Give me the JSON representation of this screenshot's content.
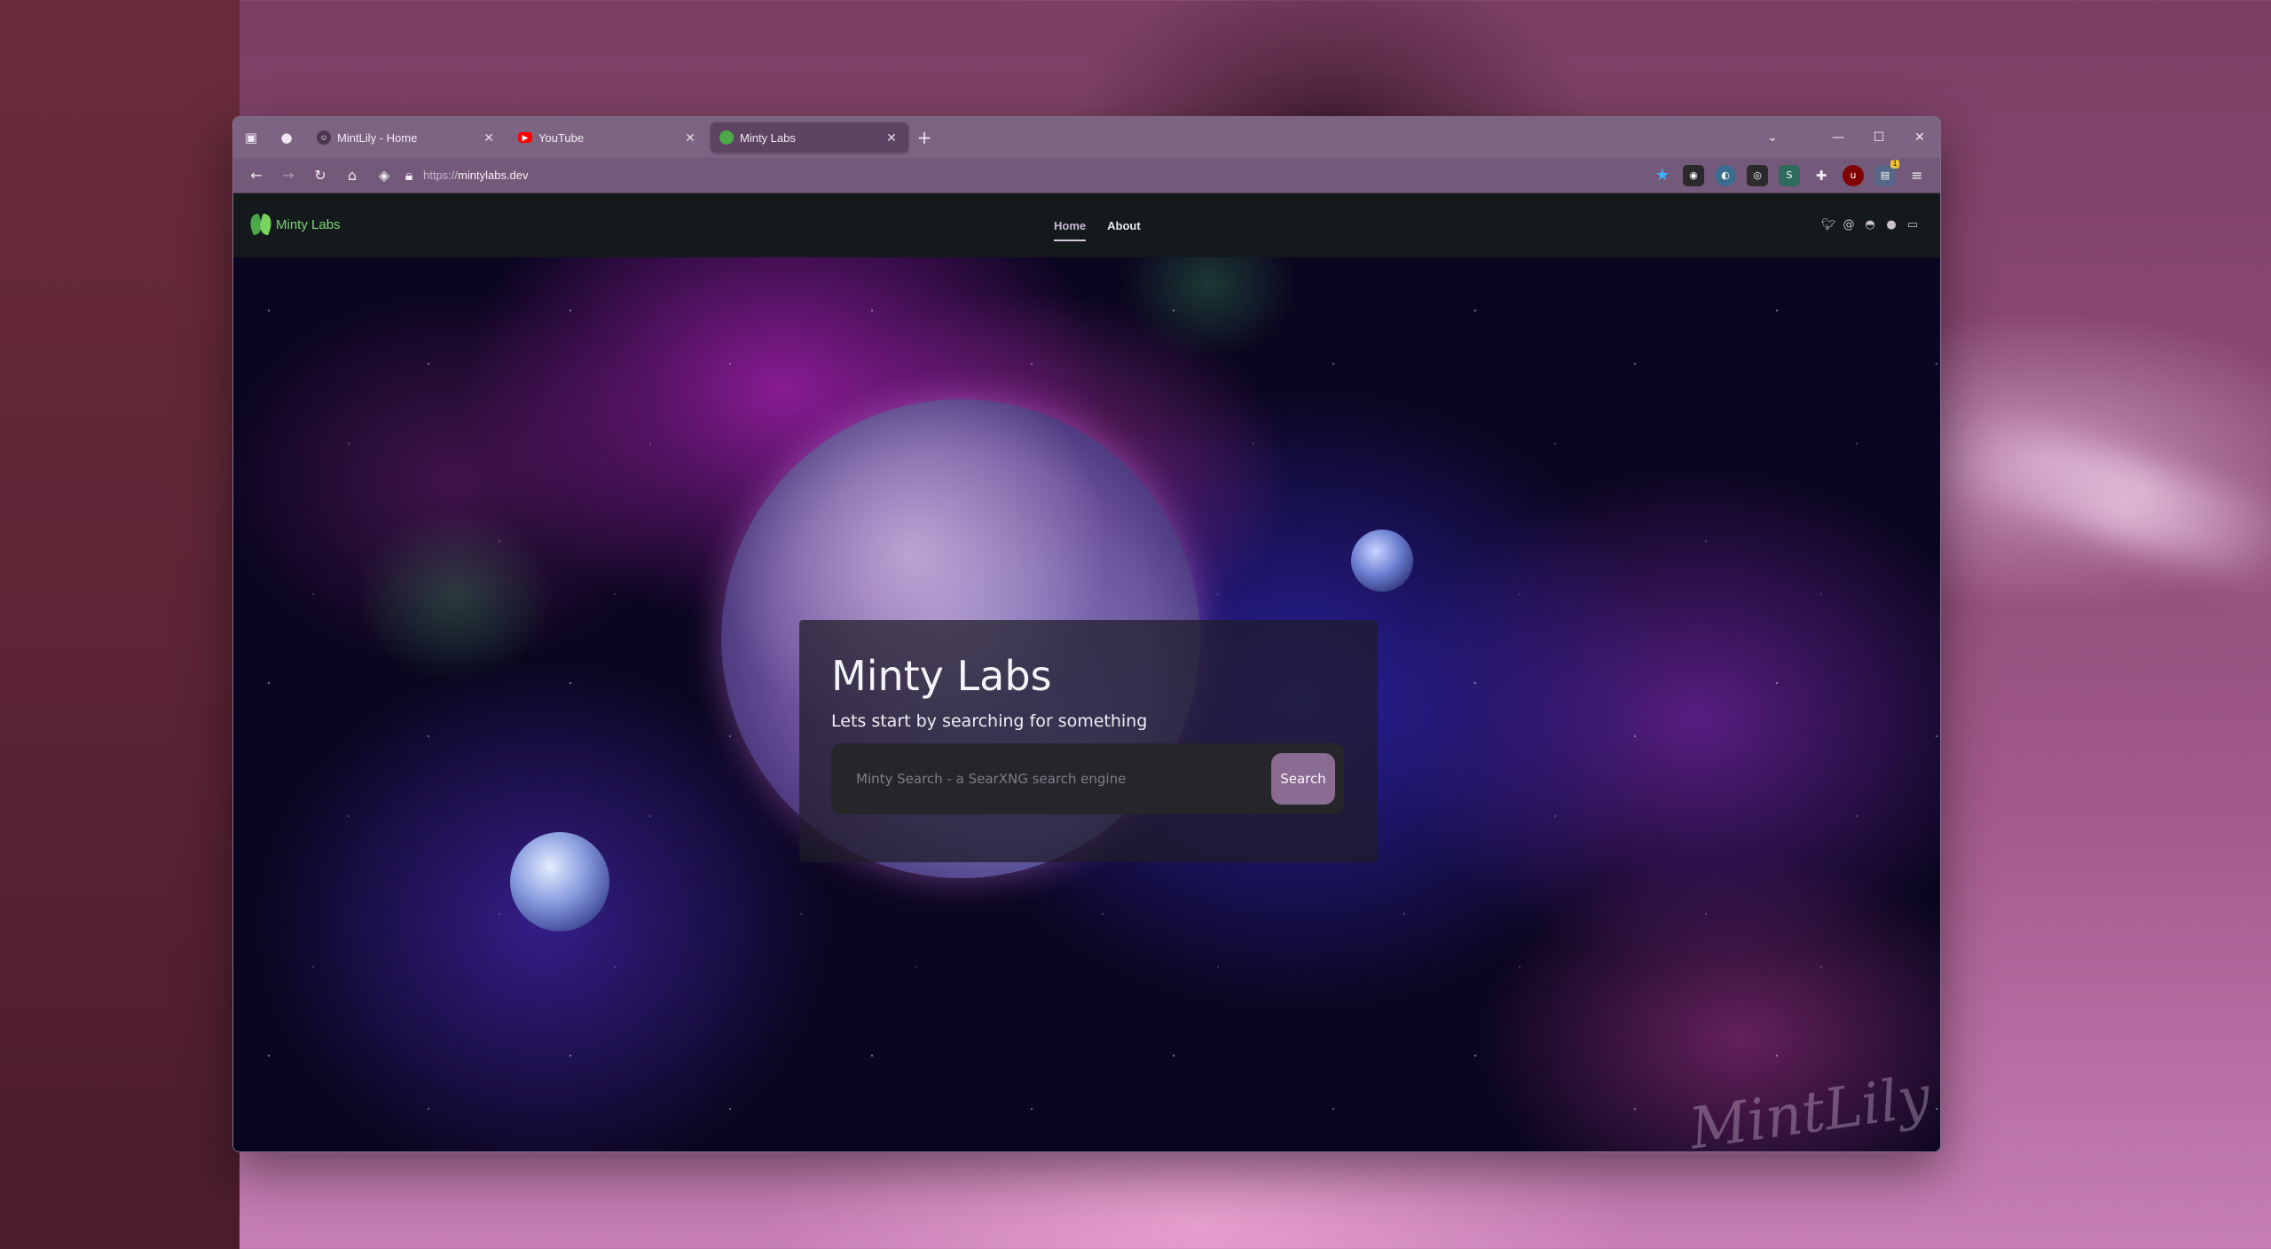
{
  "browser": {
    "tabs": [
      {
        "title": "MintLily - Home",
        "favicon": "avatar-icon",
        "active": false
      },
      {
        "title": "YouTube",
        "favicon": "youtube-icon",
        "active": false
      },
      {
        "title": "Minty Labs",
        "favicon": "leaf-icon",
        "active": true
      }
    ],
    "url": {
      "protocol": "https://",
      "host": "mintylabs.dev"
    },
    "bookmark_color": "#3fb2ff",
    "extensions": [
      "ext-icon-1",
      "ext-icon-2",
      "ext-icon-3",
      "ext-icon-4",
      "extensions-icon",
      "ublock-icon",
      "ext-icon-badge"
    ],
    "extension_badge": "1"
  },
  "site": {
    "brand": "Minty Labs",
    "nav": [
      {
        "label": "Home",
        "current": true
      },
      {
        "label": "About",
        "current": false
      }
    ],
    "social_icons": [
      "twitter-icon",
      "threads-icon",
      "discord-icon",
      "github-icon",
      "chat-icon"
    ]
  },
  "hero": {
    "title": "Minty Labs",
    "subtitle": "Lets start by searching for something",
    "search_placeholder": "Minty Search - a SearXNG search engine",
    "search_button": "Search"
  },
  "watermark": "MintLily",
  "colors": {
    "accent": "#8a6b91",
    "brand_green": "#7fd37a",
    "header_bg": "#141a1c"
  }
}
